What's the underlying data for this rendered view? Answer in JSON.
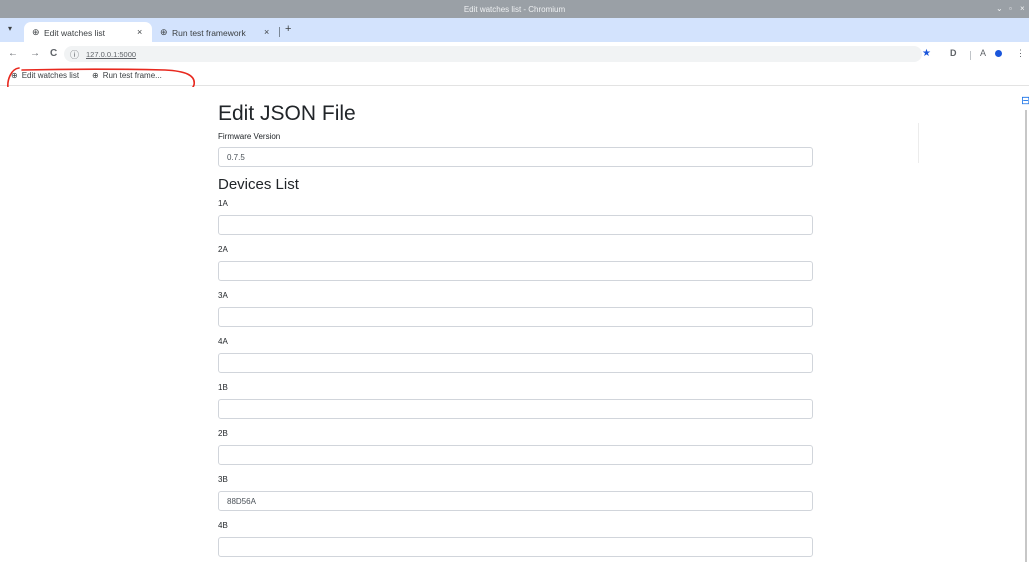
{
  "window": {
    "title": "Edit watches list - Chromium",
    "controls": [
      "⌄",
      "▫",
      "×"
    ]
  },
  "tabs": [
    {
      "label": "Edit watches list",
      "active": true
    },
    {
      "label": "Run test framework",
      "active": false
    }
  ],
  "tab_menu_icon": "chevron-down-icon",
  "new_tab_label": "+",
  "toolbar": {
    "back": "←",
    "forward": "→",
    "reload": "C",
    "info_icon": "ⓘ",
    "url": "127.0.0.1:5000",
    "star": "★",
    "ext1": "D",
    "ext2": "A"
  },
  "bookmarks": [
    {
      "label": "Edit watches list"
    },
    {
      "label": "Run test frame..."
    }
  ],
  "annotation_color": "#e8281e",
  "page": {
    "heading": "Edit JSON File",
    "firmware_label": "Firmware Version",
    "firmware_value": "0.7.5",
    "devices_heading": "Devices List",
    "devices": [
      {
        "label": "1A",
        "value": ""
      },
      {
        "label": "2A",
        "value": ""
      },
      {
        "label": "3A",
        "value": ""
      },
      {
        "label": "4A",
        "value": ""
      },
      {
        "label": "1B",
        "value": ""
      },
      {
        "label": "2B",
        "value": ""
      },
      {
        "label": "3B",
        "value": "88D56A"
      },
      {
        "label": "4B",
        "value": ""
      }
    ]
  }
}
